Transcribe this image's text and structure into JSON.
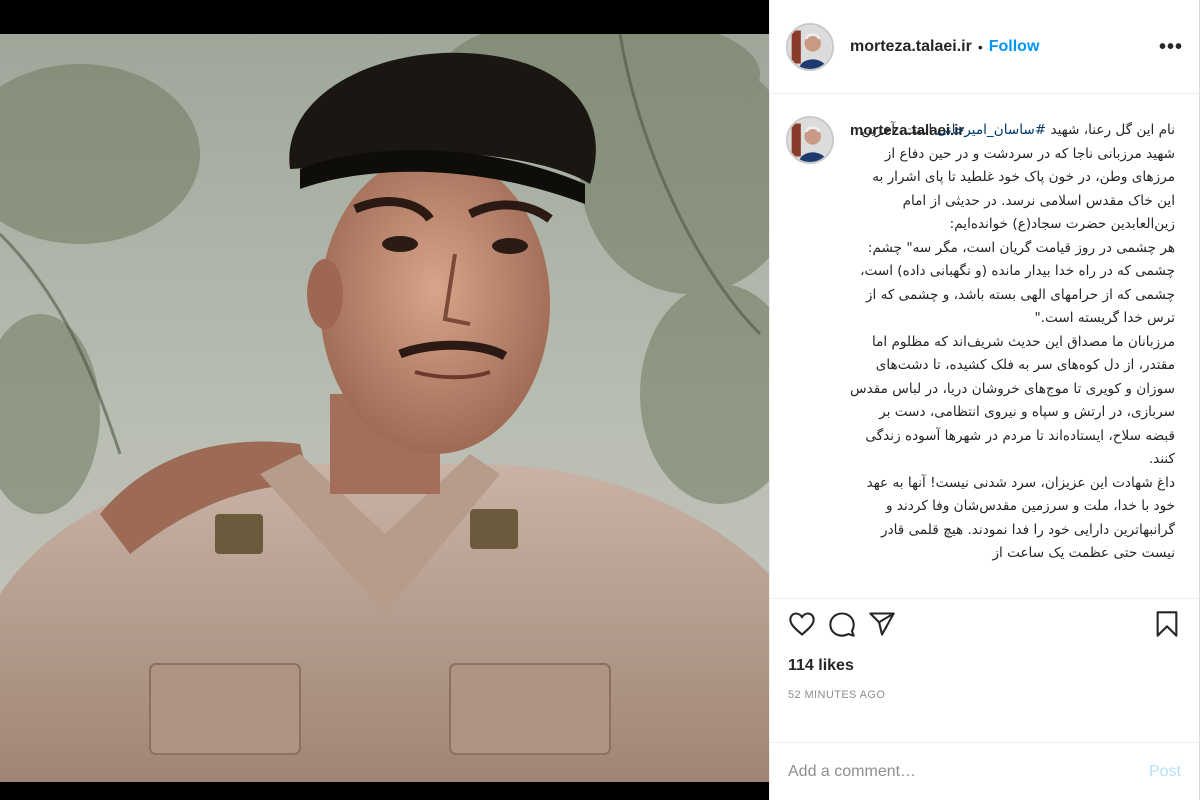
{
  "post": {
    "username": "morteza.talaei.ir",
    "separator": "•",
    "follow_label": "Follow",
    "more_label": "•••",
    "caption_username": "morteza.talaei.ir",
    "caption_hashtag": "#ساسان_امیرخانی",
    "caption_first": "نام این گل رعنا، شهید",
    "caption_rest": " است، آخرین شهید مرزبانی ناجا که در سردشت و در حین دفاع از مرزهای وطن، در خون پاک خود غلطید تا پای اشرار به این خاک مقدس اسلامی نرسد. در حدیثی از امام زین‌العابدین حضرت سجاد(ع) خوانده‌ایم:\nهر چشمی در روز قیامت گریان است، مگر سه\" چشم: چشمی که در راه خدا بیدار مانده (و نگهبانی داده) است، چشمی که از حرامهای الهی بسته باشد، و چشمی که از ترس خدا گریسته است.\"\nمرزبانان ما مصداق این حدیث شریف‌اند که مظلوم اما مقتدر، از دل کوه‌های سر به فلک کشیده، تا دشت‌های سوزان و کویری تا موج‌های خروشان دریا، در لباس مقدس سربازی، در ارتش و سپاه و نیروی انتظامی، دست بر قبضه سلاح، ایستاده‌اند تا مردم در شهرها آسوده زندگی کنند.\nداغ شهادت این عزیزان، سرد شدنی نیست! آنها به عهد خود با خدا، ملت و سرزمین مقدس‌شان وفا کردند و گرانبهاترین دارایی خود را فدا نمودند. هیچ قلمی قادر نیست حتی عظمت یک ساعت از",
    "likes": "114 likes",
    "time": "52 MINUTES AGO",
    "comment_placeholder": "Add a comment…",
    "post_label": "Post"
  },
  "icons": {
    "like": "heart-icon",
    "comment": "comment-icon",
    "share": "share-icon",
    "save": "bookmark-icon"
  },
  "colors": {
    "accent": "#0095f6",
    "post_disabled": "#b2dffc",
    "meta": "#8e8e8e",
    "text": "#262626"
  }
}
